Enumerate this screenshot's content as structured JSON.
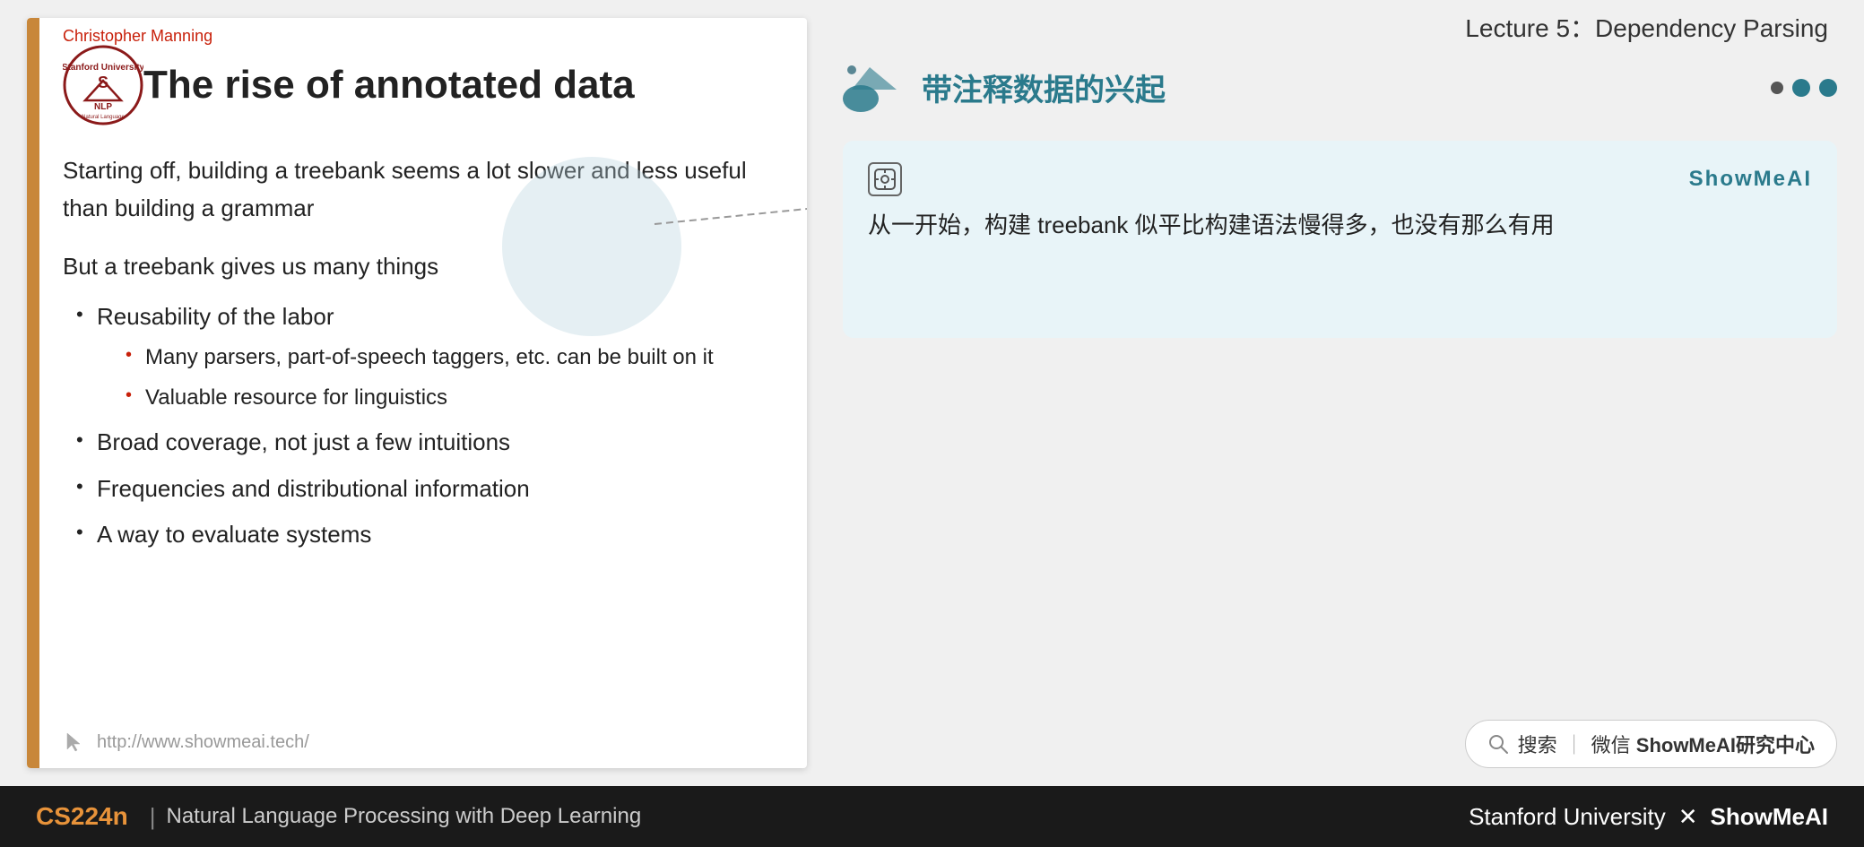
{
  "lecture": {
    "title": "Lecture 5：Dependency Parsing"
  },
  "slide": {
    "author": "Christopher Manning",
    "title": "The rise of annotated data",
    "intro_text": "Starting off, building a treebank seems a lot slower and less useful than building a grammar",
    "section_title": "But a treebank gives us many things",
    "bullets": [
      {
        "text": "Reusability of the labor",
        "sub": [
          "Many parsers, part-of-speech taggers, etc. can be built on it",
          "Valuable resource for linguistics"
        ]
      },
      {
        "text": "Broad coverage, not just a few intuitions",
        "sub": []
      },
      {
        "text": "Frequencies and distributional information",
        "sub": []
      },
      {
        "text": "A way to evaluate systems",
        "sub": []
      }
    ],
    "footer_url": "http://www.showmeai.tech/"
  },
  "annotation": {
    "brand": "ShowMeAI",
    "chinese_title": "带注释数据的兴起",
    "text": "从一开始，构建 treebank 似平比构建语法慢得多，也没有那么有用",
    "ai_icon_label": "AI"
  },
  "search": {
    "label": "搜索｜微信 ShowMeAI研究中心"
  },
  "bottom_bar": {
    "course_code": "CS224n",
    "separator": "|",
    "subtitle": "Natural Language Processing with Deep Learning",
    "university": "Stanford University",
    "x_label": "✕",
    "brand": "ShowMeAI"
  }
}
